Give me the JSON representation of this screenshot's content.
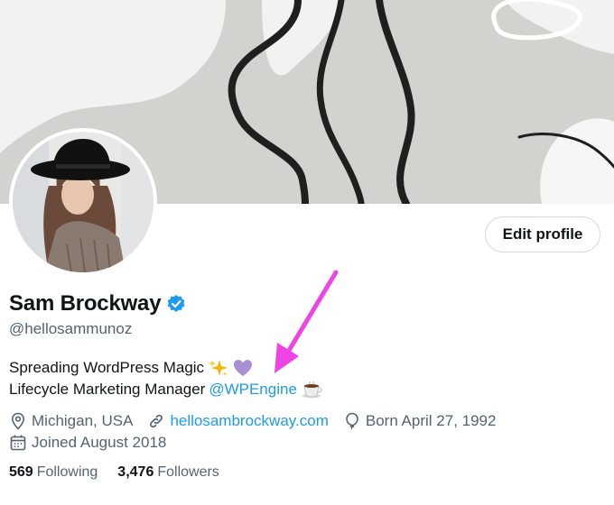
{
  "profile": {
    "display_name": "Sam Brockway",
    "handle": "@hellosammunoz",
    "edit_button_label": "Edit profile",
    "bio_line1": "Spreading WordPress Magic",
    "bio_line2_text": "Lifecycle Marketing Manager",
    "bio_line2_mention": "@WPEngine",
    "location": "Michigan, USA",
    "website": "hellosambrockway.com",
    "birthday": "Born April 27, 1992",
    "joined": "Joined August 2018",
    "following_count": "569",
    "following_label": "Following",
    "followers_count": "3,476",
    "followers_label": "Followers"
  },
  "icons": {
    "verified": "verified-badge-icon",
    "sparkles": "sparkles-emoji",
    "heart": "purple-heart-emoji",
    "coffee": "coffee-emoji",
    "location": "location-pin-icon",
    "link": "link-icon",
    "birthday": "balloon-icon",
    "calendar": "calendar-icon"
  },
  "colors": {
    "link": "#1d9bf0",
    "muted": "#536471",
    "text": "#0f1419",
    "banner_bg": "#d4d2ce",
    "annotation_arrow": "#ee44e6"
  }
}
